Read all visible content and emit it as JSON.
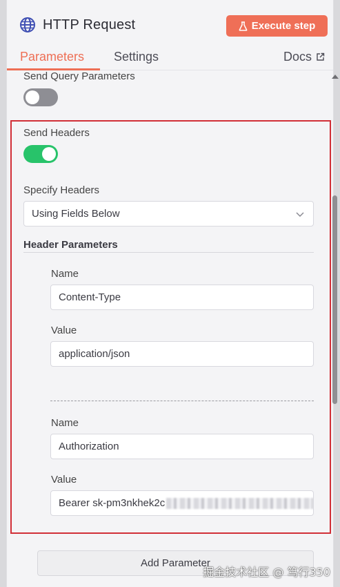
{
  "header": {
    "title": "HTTP Request",
    "execute_label": "Execute step"
  },
  "tabs": [
    {
      "label": "Parameters",
      "active": true
    },
    {
      "label": "Settings",
      "active": false
    },
    {
      "label": "Docs",
      "active": false
    }
  ],
  "query_params": {
    "label": "Send Query Parameters",
    "enabled": false
  },
  "headers": {
    "label": "Send Headers",
    "enabled": true,
    "specify_label": "Specify Headers",
    "specify_value": "Using Fields Below",
    "section_title": "Header Parameters",
    "params": [
      {
        "name_label": "Name",
        "name_value": "Content-Type",
        "value_label": "Value",
        "value_value": "application/json"
      },
      {
        "name_label": "Name",
        "name_value": "Authorization",
        "value_label": "Value",
        "value_value": "Bearer sk-pm3nkhek2c"
      }
    ]
  },
  "add_parameter_label": "Add Parameter",
  "watermark": "掘金技术社区 @ 笃行350",
  "colors": {
    "accent": "#ee6f55",
    "toggle_on": "#28c36a",
    "toggle_off": "#8e8e94",
    "highlight_border": "#d12e36"
  }
}
